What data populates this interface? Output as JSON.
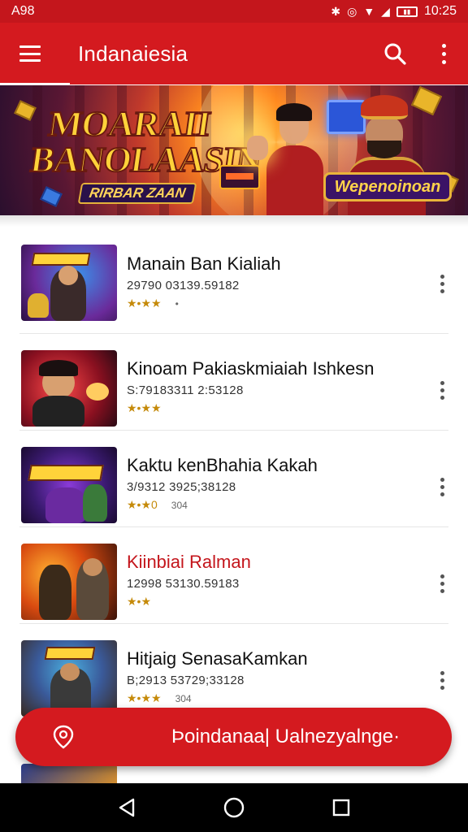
{
  "status_bar": {
    "left_text": "A98",
    "time": "10:25",
    "icons": [
      "bluetooth-icon",
      "vibrate-icon",
      "wifi-icon",
      "signal-icon",
      "battery-icon"
    ]
  },
  "app_bar": {
    "title": "Indanaiesia",
    "icons": [
      "menu-icon",
      "search-icon",
      "more-vert-icon"
    ]
  },
  "banner": {
    "title_line1": "MOARAII",
    "title_line2": "BANOLAASIN",
    "subtitle": "RIRBAR ZAAN",
    "badge": "Wepenoinoan"
  },
  "games": [
    {
      "title": "Manain Ban Kialiah",
      "meta": "29790 03139.59182",
      "rating": "★•★★",
      "extra": "•",
      "highlight": false
    },
    {
      "title": "Kinoam Pakiaskmiaiah Ishkesn",
      "meta": "S:79183311 2:53128",
      "rating": "★•★★",
      "extra": "",
      "highlight": false
    },
    {
      "title": "Kaktu kenBhahia Kakah",
      "meta": "3/9312 3925;38128",
      "rating": "★•★0",
      "extra": "304",
      "highlight": false
    },
    {
      "title": "Kiinbiai Ralman",
      "meta": "12998 53130.59183",
      "rating": "★•★",
      "extra": "",
      "highlight": true
    },
    {
      "title": "Hitjaig SenasaKamkan",
      "meta": "B;2913 53729;33128",
      "rating": "★•★★",
      "extra": "304",
      "highlight": false
    }
  ],
  "fab": {
    "icon": "location-pin-icon",
    "label": "Þoindanaa| Ualnezyalnge·"
  },
  "nav_bar": {
    "icons": [
      "back-icon",
      "home-icon",
      "recents-icon"
    ]
  },
  "colors": {
    "primary": "#d41a1f",
    "status_bar": "#c4161c",
    "highlight_text": "#c4161c",
    "star": "#c58a0a"
  }
}
